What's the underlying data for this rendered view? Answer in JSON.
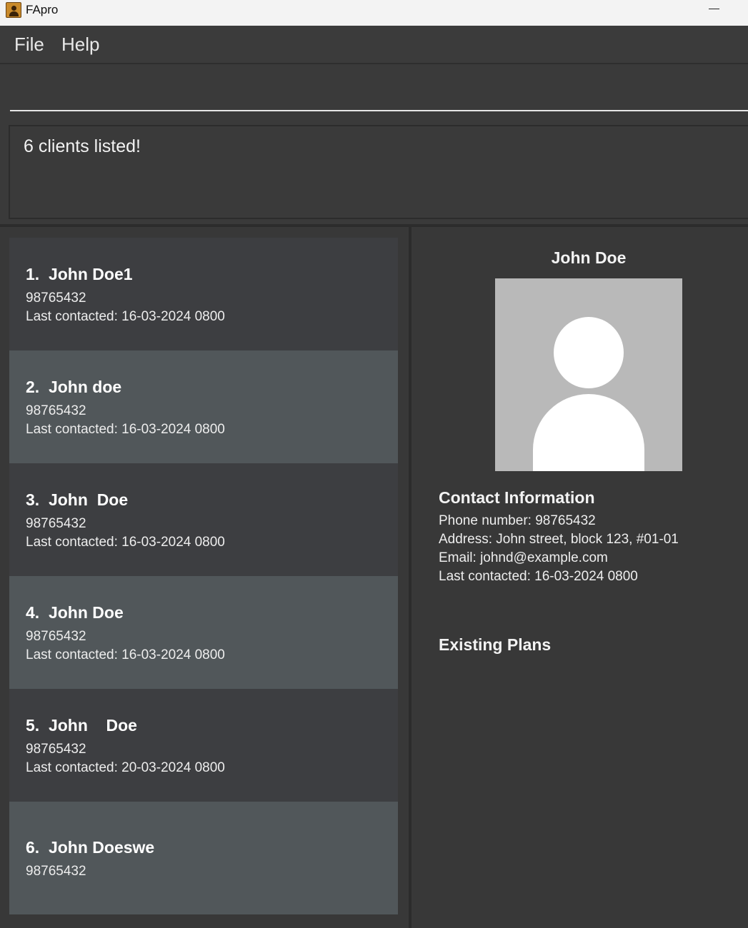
{
  "window": {
    "title": "FApro",
    "minimize_symbol": "—"
  },
  "menu": {
    "items": [
      "File",
      "Help"
    ]
  },
  "command": {
    "value": "",
    "placeholder": ""
  },
  "result": {
    "message": "6 clients listed!"
  },
  "clients": [
    {
      "index": "1.",
      "name": "John Doe1",
      "phone": "98765432",
      "last_contacted": "Last contacted: 16-03-2024 0800"
    },
    {
      "index": "2.",
      "name": "John doe",
      "phone": "98765432",
      "last_contacted": "Last contacted: 16-03-2024 0800"
    },
    {
      "index": "3.",
      "name": "John  Doe",
      "phone": "98765432",
      "last_contacted": "Last contacted: 16-03-2024 0800"
    },
    {
      "index": "4.",
      "name": "John Doe",
      "phone": "98765432",
      "last_contacted": "Last contacted: 16-03-2024 0800"
    },
    {
      "index": "5.",
      "name": "John    Doe",
      "phone": "98765432",
      "last_contacted": "Last contacted: 20-03-2024 0800"
    },
    {
      "index": "6.",
      "name": "John Doeswe",
      "phone": "98765432",
      "last_contacted": ""
    }
  ],
  "detail": {
    "name": "John Doe",
    "avatar_icon": "person-placeholder-icon",
    "contact_heading": "Contact Information",
    "phone": "Phone number: 98765432",
    "address": "Address: John street, block 123, #01-01",
    "email": "Email: johnd@example.com",
    "last_contacted": "Last contacted: 16-03-2024 0800",
    "plans_heading": "Existing Plans"
  },
  "colors": {
    "background": "#3a3a3a",
    "card_odd": "#3d3e41",
    "card_even": "#51575a",
    "text": "#ffffff"
  }
}
